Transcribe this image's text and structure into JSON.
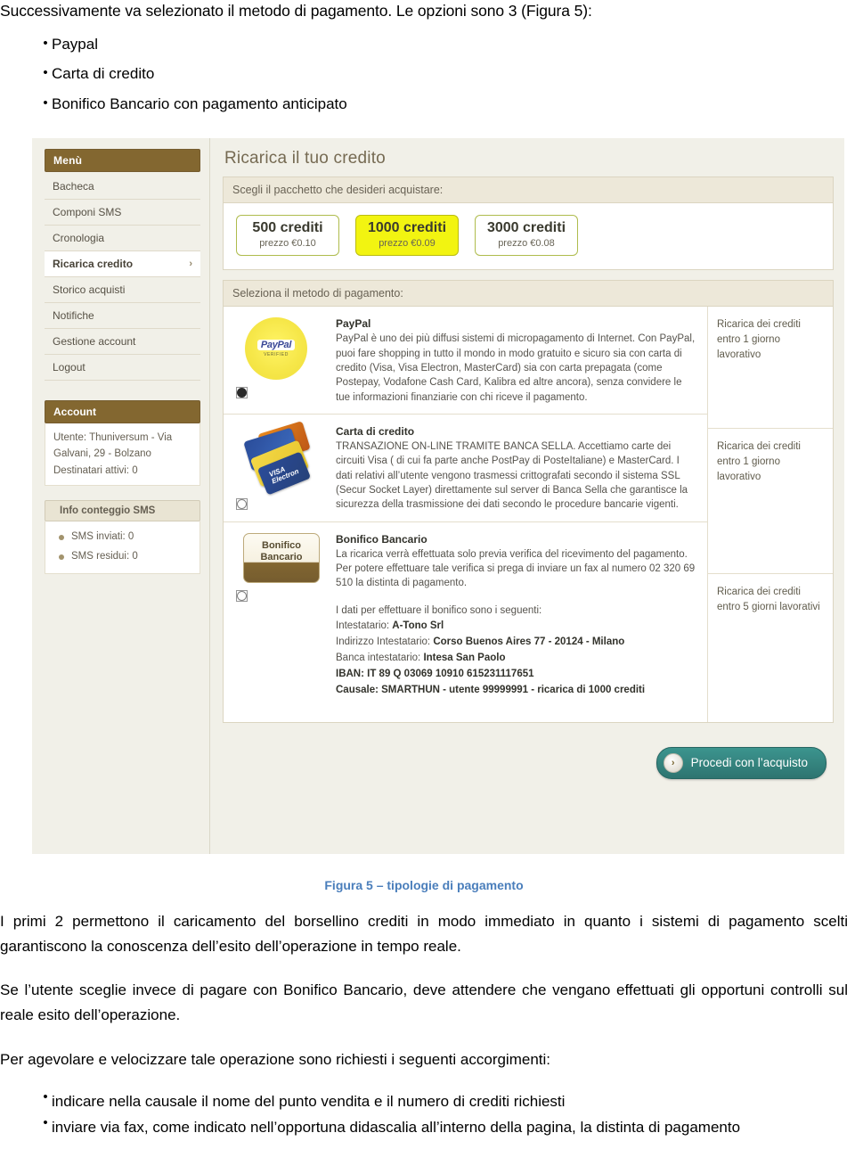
{
  "document": {
    "intro": "Successivamente va selezionato il metodo di pagamento. Le opzioni sono 3 (Figura 5):",
    "options": [
      "Paypal",
      "Carta di credito",
      "Bonifico Bancario con pagamento anticipato"
    ],
    "caption": "Figura 5 – tipologie di pagamento",
    "paragraphs": [
      "I primi 2 permettono il caricamento del borsellino crediti in modo immediato in quanto i sistemi di pagamento scelti garantiscono la conoscenza dell’esito dell’operazione in tempo reale.",
      "Se l’utente sceglie invece di pagare con Bonifico Bancario, deve attendere che vengano effettuati gli opportuni controlli sul reale esito dell’operazione.",
      "Per agevolare e velocizzare tale operazione sono richiesti i seguenti accorgimenti:"
    ],
    "final_bullets": [
      "indicare nella causale il nome del punto vendita e il numero di crediti richiesti",
      "inviare via fax, come indicato nell’opportuna didascalia all’interno della pagina, la distinta di pagamento"
    ]
  },
  "screenshot": {
    "sidebar": {
      "menu_header": "Menù",
      "items": [
        {
          "label": "Bacheca",
          "active": false,
          "chevron": ""
        },
        {
          "label": "Componi SMS",
          "active": false,
          "chevron": ""
        },
        {
          "label": "Cronologia",
          "active": false,
          "chevron": ""
        },
        {
          "label": "Ricarica credito",
          "active": true,
          "chevron": "›"
        },
        {
          "label": "Storico acquisti",
          "active": false,
          "chevron": ""
        },
        {
          "label": "Notifiche",
          "active": false,
          "chevron": ""
        },
        {
          "label": "Gestione account",
          "active": false,
          "chevron": ""
        },
        {
          "label": "Logout",
          "active": false,
          "chevron": ""
        }
      ],
      "account_header": "Account",
      "account_user": "Utente: Thuniversum - Via Galvani, 29 - Bolzano",
      "account_recipients": "Destinatari attivi: 0",
      "sms_header": "Info conteggio SMS",
      "sms_sent": "SMS inviati: 0",
      "sms_left": "SMS residui: 0"
    },
    "main": {
      "title": "Ricarica il tuo credito",
      "package_panel_header": "Scegli il pacchetto che desideri acquistare:",
      "packages": [
        {
          "credits": "500 crediti",
          "price": "prezzo €0.10",
          "selected": false
        },
        {
          "credits": "1000 crediti",
          "price": "prezzo €0.09",
          "selected": true
        },
        {
          "credits": "3000 crediti",
          "price": "prezzo €0.08",
          "selected": false
        }
      ],
      "payment_panel_header": "Seleziona il metodo di pagamento:",
      "methods": [
        {
          "name": "PayPal",
          "logo_text": "PayPal",
          "logo_sub": "VERIFIED",
          "selected": true,
          "description": "PayPal è uno dei più diffusi sistemi di micropagamento di Internet. Con PayPal, puoi fare shopping in tutto il mondo in modo gratuito e sicuro sia con carta di credito (Visa, Visa Electron, MasterCard) sia con carta prepagata (come Postepay, Vodafone Cash Card, Kalibra ed altre ancora), senza convidere le tue informazioni finanziarie con chi riceve il pagamento.",
          "timing": "Ricarica dei crediti entro 1 giorno lavorativo"
        },
        {
          "name": "Carta di credito",
          "logo_text": "VISA",
          "logo_sub": "VISA Electron",
          "selected": false,
          "description": "TRANSAZIONE ON-LINE TRAMITE BANCA SELLA. Accettiamo carte dei circuiti Visa ( di cui fa parte anche PostPay di PosteItaliane) e MasterCard. I dati relativi all’utente vengono trasmessi crittografati secondo il sistema SSL (Secur Socket Layer) direttamente sul server di Banca Sella che garantisce la sicurezza della trasmissione dei dati secondo le procedure bancarie vigenti.",
          "timing": "Ricarica dei crediti entro 1 giorno lavorativo"
        },
        {
          "name": "Bonifico Bancario",
          "logo_text": "Bonifico Bancario",
          "logo_sub": "",
          "selected": false,
          "description": "La ricarica verrà effettuata solo previa verifica del ricevimento del pagamento.\nPer potere effettuare tale verifica si prega di inviare un fax al numero 02 320 69 510 la distinta di pagamento.",
          "timing": "Ricarica dei crediti entro 5 giorni lavorativi"
        }
      ],
      "bank_details": {
        "intro": "I dati per effettuare il bonifico sono i seguenti:",
        "rows": [
          {
            "label": "Intestatario: ",
            "value": "A-Tono Srl"
          },
          {
            "label": "Indirizzo Intestatario: ",
            "value": "Corso Buenos Aires 77 - 20124 - Milano"
          },
          {
            "label": "Banca intestatario: ",
            "value": "Intesa San Paolo"
          },
          {
            "label": "IBAN: ",
            "value": "IT 89 Q 03069 10910 615231117651"
          },
          {
            "label": "Causale: ",
            "value": "SMARTHUN - utente 99999991 - ricarica di 1000 crediti"
          }
        ]
      },
      "cta_label": "Procedi con l’acquisto",
      "cta_icon": "›"
    }
  }
}
